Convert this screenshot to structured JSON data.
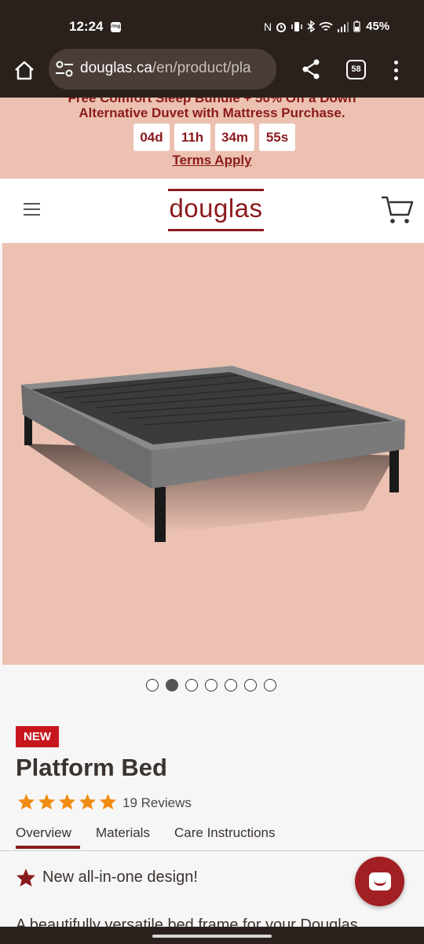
{
  "status_bar": {
    "time": "12:24",
    "ring_label": "ring",
    "nfc_icon": "N",
    "battery": "45%",
    "icons": [
      "nfc-icon",
      "alarm-icon",
      "vibrate-icon",
      "bluetooth-icon",
      "wifi-icon",
      "signal-icon",
      "battery-icon"
    ]
  },
  "browser": {
    "url_host": "douglas.ca",
    "url_path": "/en/product/pla",
    "tab_count": "58"
  },
  "promo": {
    "line1": "Free Comfort Sleep Bundle + 50% Off a Down",
    "line2": "Alternative Duvet with Mattress Purchase.",
    "countdown": {
      "days": "04d",
      "hours": "11h",
      "minutes": "34m",
      "seconds": "55s"
    },
    "terms": "Terms Apply"
  },
  "header": {
    "logo": "douglas"
  },
  "carousel": {
    "total": 7,
    "active_index": 1
  },
  "product": {
    "badge": "NEW",
    "title": "Platform Bed",
    "rating": 5,
    "reviews": "19 Reviews",
    "tabs": [
      "Overview",
      "Materials",
      "Care Instructions"
    ],
    "active_tab": "Overview",
    "feature": "New all-in-one design!",
    "description": "A beautifully versatile bed frame for your Douglas"
  },
  "colors": {
    "brand": "#8b1a1d",
    "promo_bg": "#ecc1b1",
    "badge_red": "#c8161d",
    "star": "#f08c12"
  }
}
